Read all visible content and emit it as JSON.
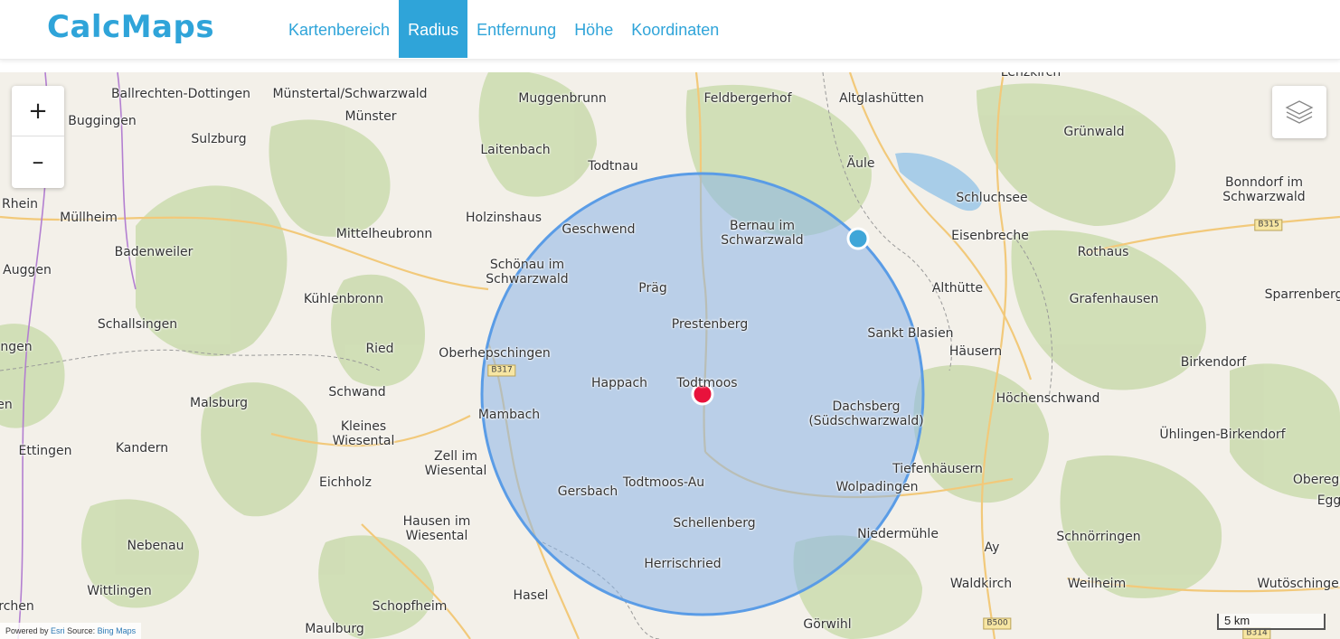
{
  "app": {
    "brand": "CalcMaps"
  },
  "nav": {
    "items": [
      {
        "label": "Kartenbereich",
        "active": false
      },
      {
        "label": "Radius",
        "active": true
      },
      {
        "label": "Entfernung",
        "active": false
      },
      {
        "label": "Höhe",
        "active": false
      },
      {
        "label": "Koordinaten",
        "active": false
      }
    ]
  },
  "map": {
    "zoom_in_label": "+",
    "zoom_out_label": "–",
    "layers_icon": "layers-icon",
    "scale_label": "5 km",
    "attribution": {
      "prefix": "Powered by",
      "esri": "Esri",
      "source": "Source:",
      "bing": "Bing Maps"
    },
    "circle": {
      "fill": "#8ab4e8",
      "stroke": "#5a9ce6"
    },
    "center_marker_color": "#e8123c",
    "radius_handle_color": "#3fa6d8",
    "places": [
      "Ballrechten-Dottingen",
      "Münstertal/Schwarzwald",
      "Muggenbrunn",
      "Feldbergerhof",
      "Altglashütten",
      "Lenzkirch",
      "Buggingen",
      "Münster",
      "Sulzburg",
      "Laitenbach",
      "Todtnau",
      "Äule",
      "Grünwald",
      "Schluchsee",
      "Bonndorf im\nSchwarzwald",
      "Rhein",
      "Müllheim",
      "Holzinshaus",
      "Geschwend",
      "Bernau im\nSchwarzwald",
      "Eisenbreche",
      "Mittelheubronn",
      "Badenweiler",
      "Rothaus",
      "Auggen",
      "Schönau im\nSchwarzwald",
      "Präg",
      "Althütte",
      "Grafenhausen",
      "Sparrenberg",
      "Kühlenbronn",
      "Schallsingen",
      "Prestenberg",
      "Sankt Blasien",
      "Häusern",
      "ngen",
      "Ried",
      "Oberhepschingen",
      "Birkendorf",
      "Happach",
      "Todtmoos",
      "Schwand",
      "Höchenschwand",
      "Malsburg",
      "Dachsberg\n(Südschwarzwald)",
      "Mambach",
      "Kleines\nWiesental",
      "Ettingen",
      "Kandern",
      "Zell im\nWiesental",
      "Ühlingen-Birkendorf",
      "Tiefenhäusern",
      "Eichholz",
      "Todtmoos-Au",
      "Gersbach",
      "Wolpadingen",
      "Oberegg",
      "Egg",
      "Hausen im\nWiesental",
      "Schellenberg",
      "Niedermühle",
      "Nebenau",
      "Ay",
      "Schnörringen",
      "Herrischried",
      "Waldkirch",
      "Weilheim",
      "Wutöschingen",
      "Wittlingen",
      "Hasel",
      "Schopfheim",
      "rchen",
      "Maulburg",
      "Görwihl",
      "en"
    ],
    "road_shields": [
      "B317",
      "B315",
      "B500",
      "B314"
    ]
  }
}
